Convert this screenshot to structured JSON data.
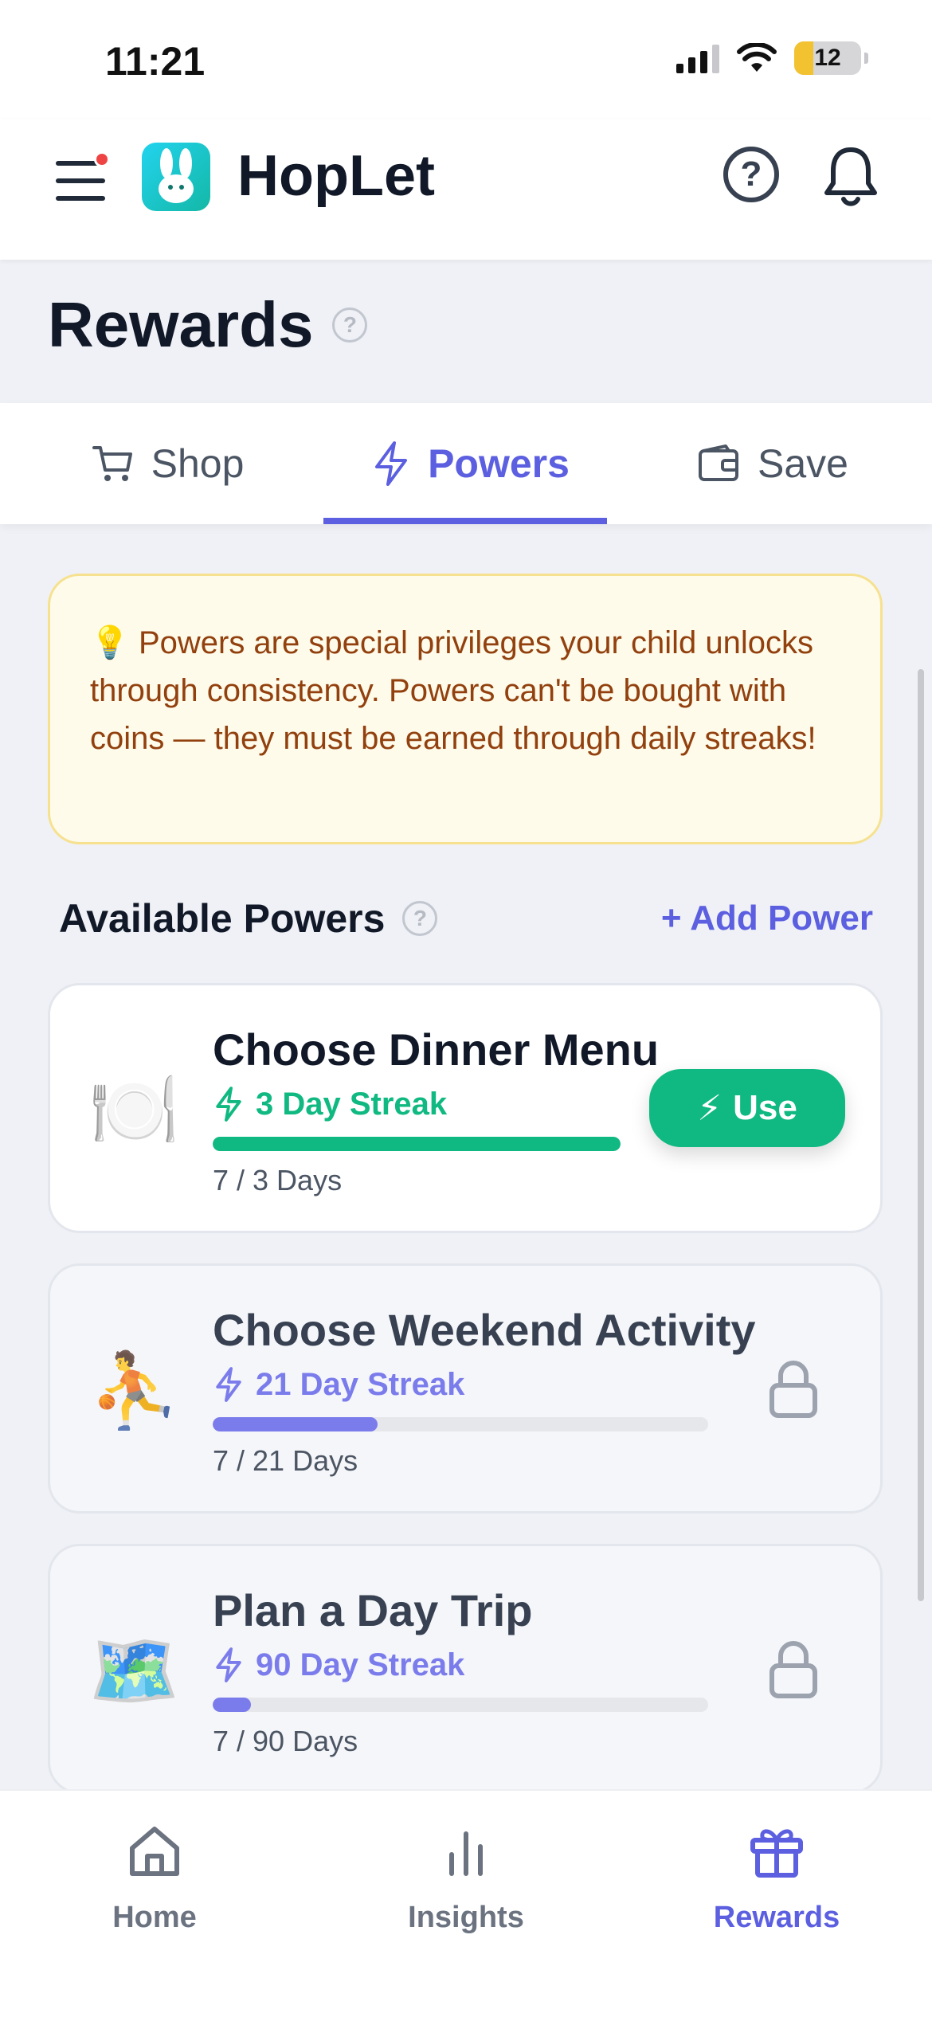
{
  "status_bar": {
    "time": "11:21",
    "battery": "12"
  },
  "header": {
    "app_name": "HopLet",
    "help_icon": "?"
  },
  "page": {
    "title": "Rewards",
    "help_icon": "?"
  },
  "tabs": [
    {
      "label": "Shop",
      "icon": "cart-icon",
      "active": false
    },
    {
      "label": "Powers",
      "icon": "bolt-icon",
      "active": true
    },
    {
      "label": "Save",
      "icon": "wallet-icon",
      "active": false
    }
  ],
  "info": {
    "emoji": "💡",
    "text": "Powers are special privileges your child unlocks through consistency. Powers can't be bought with coins — they must be earned through daily streaks!"
  },
  "section": {
    "title": "Available Powers",
    "help_icon": "?",
    "add_label": "+ Add Power"
  },
  "powers": [
    {
      "emoji": "🍽️",
      "name": "Choose Dinner Menu",
      "streak": "3 Day Streak",
      "progress": 1.0,
      "days": "7 / 3 Days",
      "status": "unlocked",
      "action_label": "Use",
      "action_emoji": "⚡",
      "color": "#10b981"
    },
    {
      "emoji": "⛹️",
      "name": "Choose Weekend Activity",
      "streak": "21 Day Streak",
      "progress": 0.3333,
      "days": "7 / 21 Days",
      "status": "locked",
      "color": "#7b7cec"
    },
    {
      "emoji": "🗺️",
      "name": "Plan a Day Trip",
      "streak": "90 Day Streak",
      "progress": 0.0778,
      "days": "7 / 90 Days",
      "status": "locked",
      "color": "#7b7cec"
    }
  ],
  "bottom_nav": [
    {
      "label": "Home",
      "icon": "home-icon",
      "active": false
    },
    {
      "label": "Insights",
      "icon": "chart-icon",
      "active": false
    },
    {
      "label": "Rewards",
      "icon": "gift-icon",
      "active": true
    }
  ],
  "colors": {
    "accent": "#5b5fe0",
    "success": "#10b981",
    "info_bg": "#fefbea",
    "info_text": "#92400e"
  }
}
